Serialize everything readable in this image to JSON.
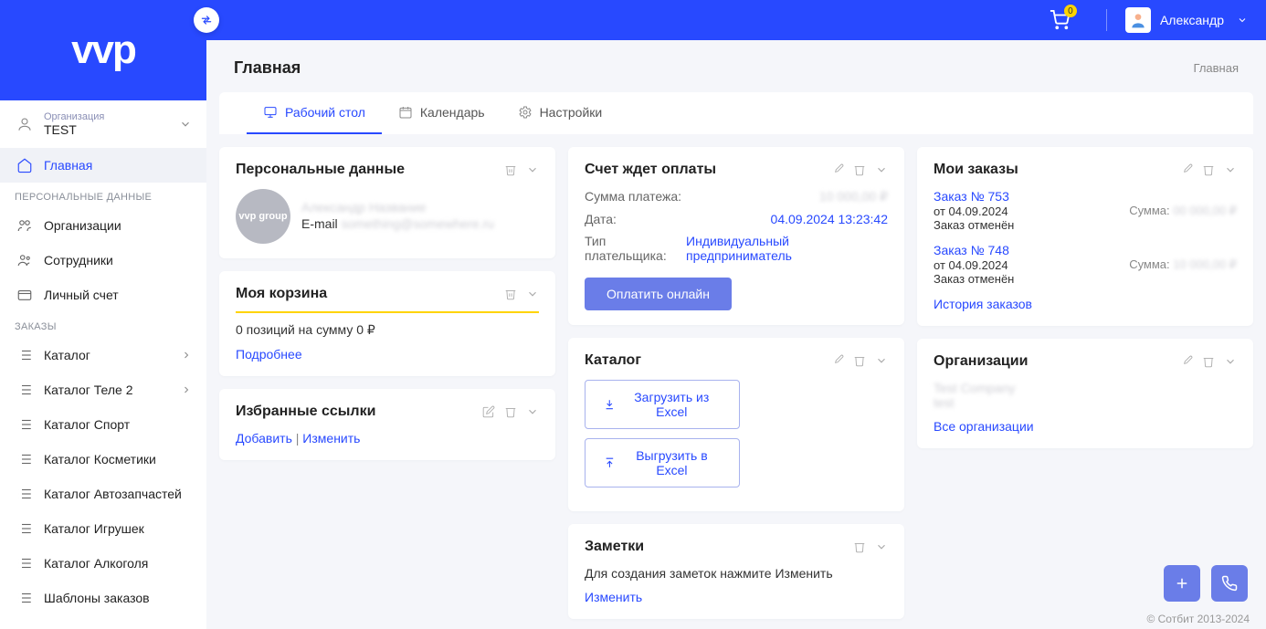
{
  "header": {
    "cart_count": "0",
    "user_name": "Александр"
  },
  "logo": "vvp",
  "sidebar": {
    "org_label": "Организация",
    "org_name": "TEST",
    "nav_main": "Главная",
    "section_personal": "ПЕРСОНАЛЬНЫЕ ДАННЫЕ",
    "nav_orgs": "Организации",
    "nav_staff": "Сотрудники",
    "nav_account": "Личный счет",
    "section_orders": "ЗАКАЗЫ",
    "nav_catalog": "Каталог",
    "nav_catalog_tele2": "Каталог Теле 2",
    "nav_catalog_sport": "Каталог Спорт",
    "nav_catalog_cosmetics": "Каталог Косметики",
    "nav_catalog_autoparts": "Каталог Автозапчастей",
    "nav_catalog_toys": "Каталог Игрушек",
    "nav_catalog_alcohol": "Каталог Алкоголя",
    "nav_templates": "Шаблоны заказов"
  },
  "page": {
    "title": "Главная",
    "breadcrumb": "Главная"
  },
  "tabs": {
    "desktop": "Рабочий стол",
    "calendar": "Календарь",
    "settings": "Настройки"
  },
  "personal": {
    "title": "Персональные данные",
    "avatar_text": "vvp group",
    "name_blur": "Александр Название",
    "email_label": "E-mail",
    "email_blur": "something@somewhere.ru"
  },
  "cart": {
    "title": "Моя корзина",
    "summary": "0 позиций на сумму 0 ₽",
    "more": "Подробнее"
  },
  "favlinks": {
    "title": "Избранные ссылки",
    "add": "Добавить",
    "edit": "Изменить"
  },
  "invoice": {
    "title": "Счет ждет оплаты",
    "sum_label": "Сумма платежа:",
    "sum_value": "10 000,00 ₽",
    "date_label": "Дата:",
    "date_value": "04.09.2024 13:23:42",
    "payer_label": "Тип плательщика:",
    "payer_value": "Индивидуальный предприниматель",
    "pay_btn": "Оплатить онлайн"
  },
  "catalog": {
    "title": "Каталог",
    "import": "Загрузить из Excel",
    "export": "Выгрузить в Excel"
  },
  "notes": {
    "title": "Заметки",
    "text": "Для создания заметок нажмите Изменить",
    "edit": "Изменить"
  },
  "orders": {
    "title": "Мои заказы",
    "items": [
      {
        "no": "Заказ № 753",
        "date": "от 04.09.2024",
        "sum_label": "Сумма:",
        "sum": "00 000,00 ₽",
        "status": "Заказ отменён"
      },
      {
        "no": "Заказ № 748",
        "date": "от 04.09.2024",
        "sum_label": "Сумма:",
        "sum": "10 000,00 ₽",
        "status": "Заказ отменён"
      }
    ],
    "history": "История заказов"
  },
  "orgs_card": {
    "title": "Организации",
    "blur_line1": "Test Company",
    "blur_line2": "test",
    "all": "Все организации"
  },
  "footer": "© Сотбит 2013-2024"
}
